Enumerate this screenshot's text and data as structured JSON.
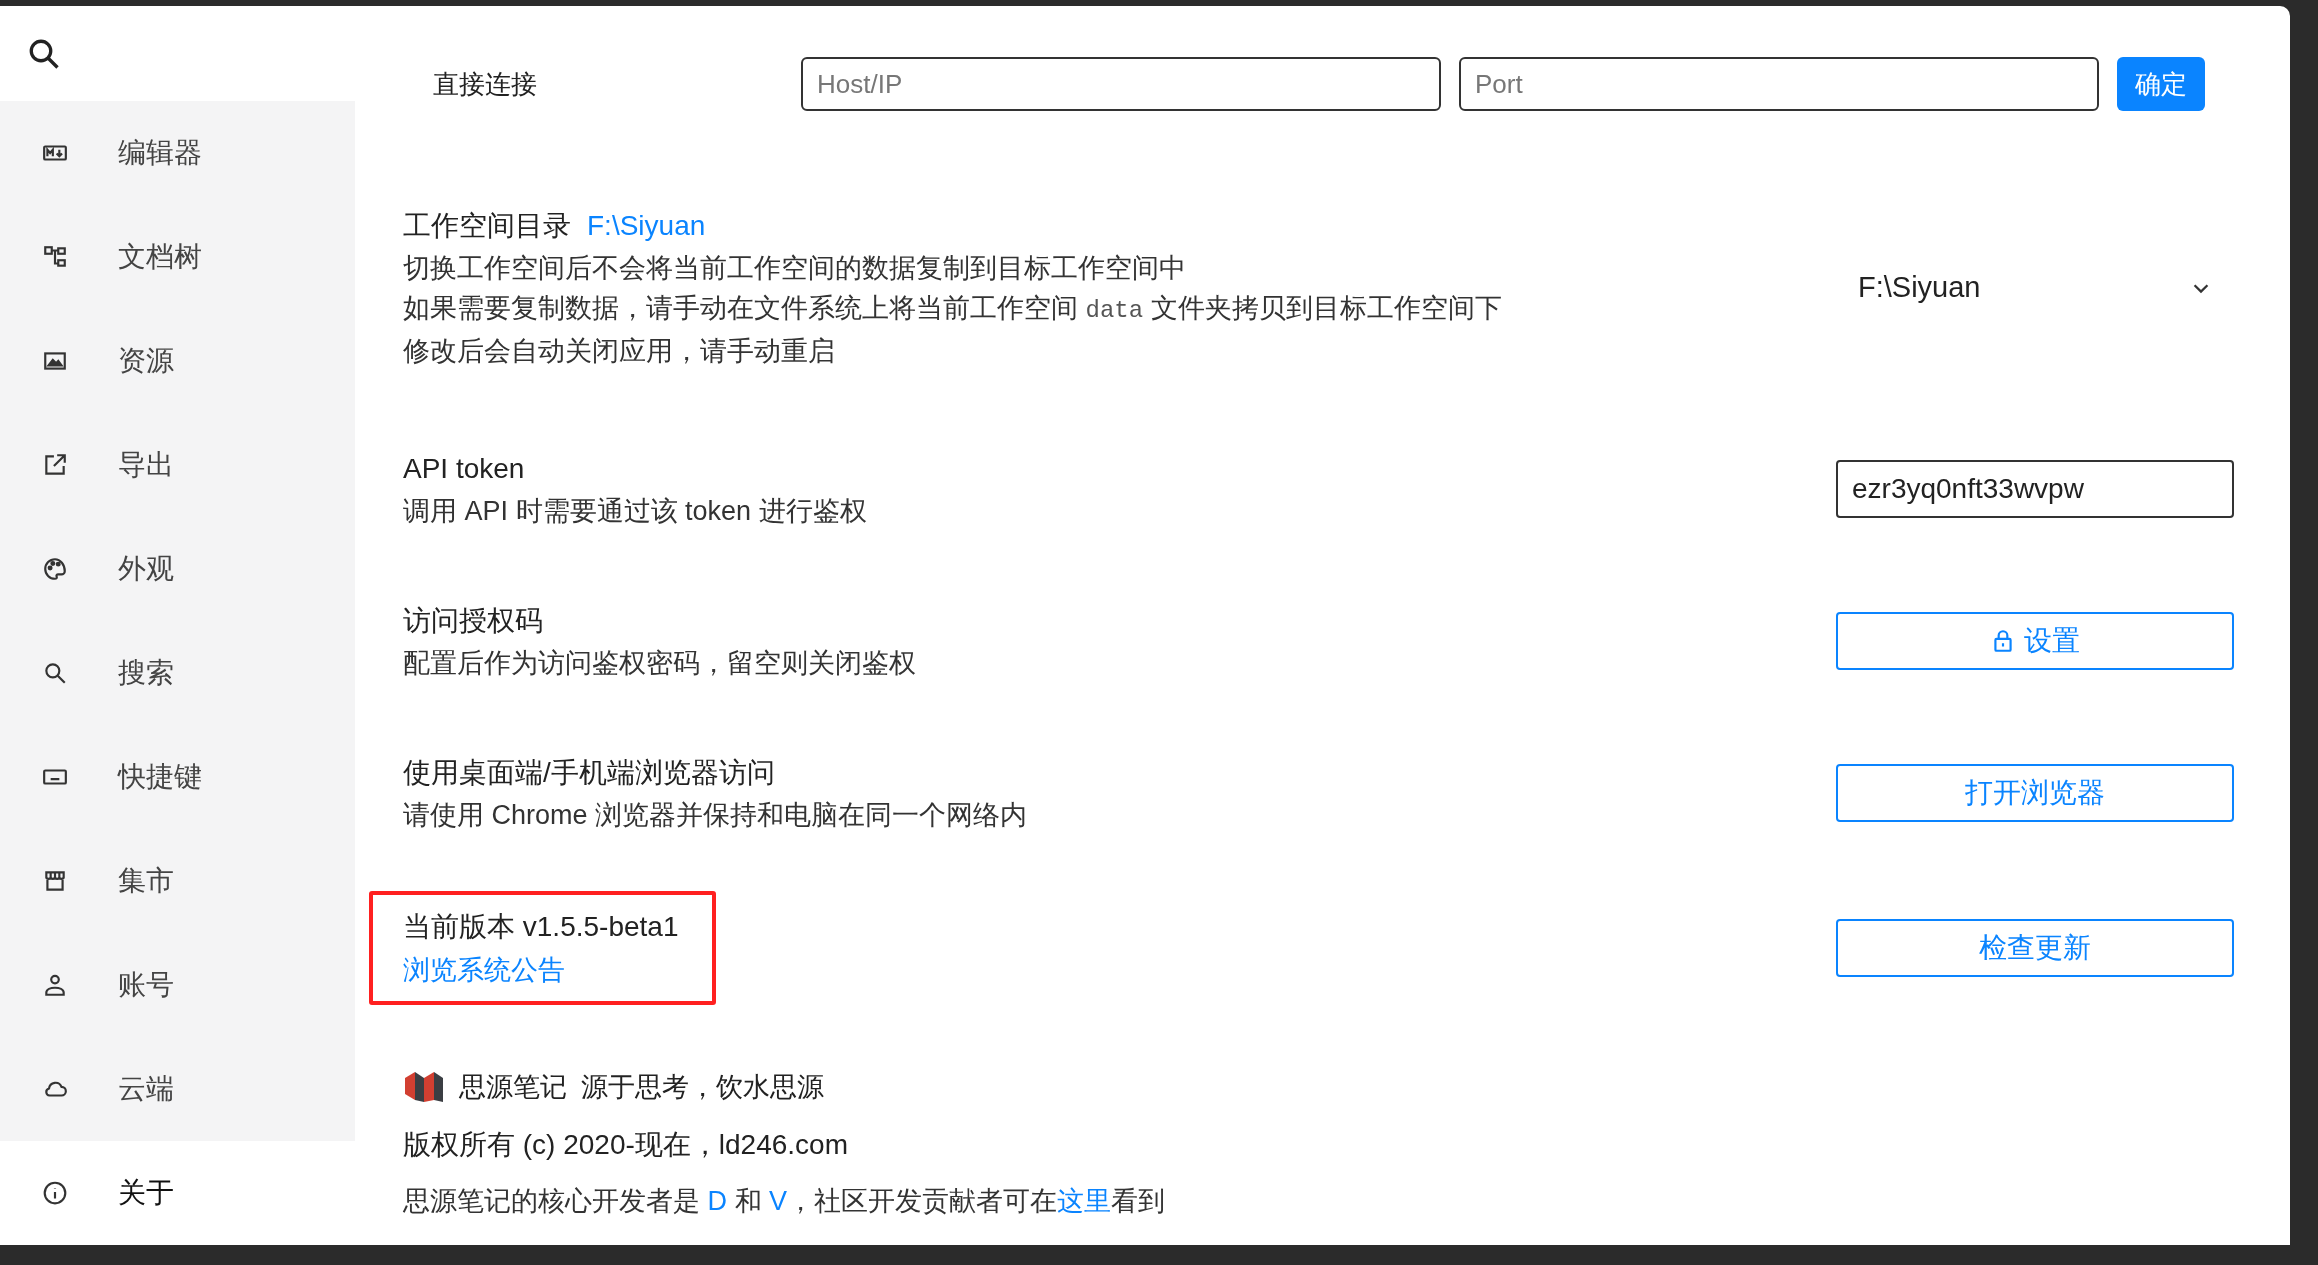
{
  "sidebar": {
    "items": [
      {
        "label": "编辑器",
        "selected": false
      },
      {
        "label": "文档树",
        "selected": false
      },
      {
        "label": "资源",
        "selected": false
      },
      {
        "label": "导出",
        "selected": false
      },
      {
        "label": "外观",
        "selected": false
      },
      {
        "label": "搜索",
        "selected": false
      },
      {
        "label": "快捷键",
        "selected": false
      },
      {
        "label": "集市",
        "selected": false
      },
      {
        "label": "账号",
        "selected": false
      },
      {
        "label": "云端",
        "selected": false
      },
      {
        "label": "关于",
        "selected": true
      }
    ]
  },
  "direct_connect": {
    "label": "直接连接",
    "host": {
      "placeholder": "Host/IP"
    },
    "port": {
      "placeholder": "Port"
    },
    "button": "确定"
  },
  "settings": [
    {
      "kind": "select",
      "title": "工作空间目录",
      "title_link": "F:\\Siyuan",
      "lines": [
        [
          {
            "kind": "text",
            "text": "切换工作空间后不会将当前工作空间的数据复制到目标工作空间中"
          }
        ],
        [
          {
            "kind": "text",
            "text": "如果需要复制数据，请手动在文件系统上将当前工作空间 "
          },
          {
            "kind": "code",
            "text": "data"
          },
          {
            "kind": "text",
            "text": " 文件夹拷贝到目标工作空间下"
          }
        ],
        [
          {
            "kind": "text",
            "text": "修改后会自动关闭应用，请手动重启"
          }
        ]
      ],
      "value": "F:\\Siyuan"
    },
    {
      "kind": "input",
      "title": "API token",
      "lines": [
        [
          {
            "kind": "text",
            "text": "调用 API 时需要通过该 token 进行鉴权"
          }
        ]
      ],
      "value": "ezr3yq0nft33wvpw"
    },
    {
      "kind": "button",
      "title": "访问授权码",
      "lines": [
        [
          {
            "kind": "text",
            "text": "配置后作为访问鉴权密码，留空则关闭鉴权"
          }
        ]
      ],
      "button": "设置"
    },
    {
      "kind": "button",
      "title": "使用桌面端/手机端浏览器访问",
      "lines": [
        [
          {
            "kind": "text",
            "text": "请使用 Chrome 浏览器并保持和电脑在同一个网络内"
          }
        ]
      ],
      "button": "打开浏览器"
    },
    {
      "kind": "button",
      "title": "当前版本 v1.5.5-beta1",
      "link": "浏览系统公告",
      "button": "检查更新"
    }
  ],
  "footer": {
    "app_name": "思源笔记",
    "slogan": "源于思考，饮水思源",
    "copyright": "版权所有 (c) 2020-现在，ld246.com",
    "developers": [
      {
        "kind": "text",
        "text": "思源笔记的核心开发者是 "
      },
      {
        "kind": "link",
        "text": "D"
      },
      {
        "kind": "text",
        "text": " 和 "
      },
      {
        "kind": "link",
        "text": "V"
      },
      {
        "kind": "text",
        "text": "，社区开发贡献者可在"
      },
      {
        "kind": "link",
        "text": "这里"
      },
      {
        "kind": "text",
        "text": "看到"
      }
    ]
  }
}
